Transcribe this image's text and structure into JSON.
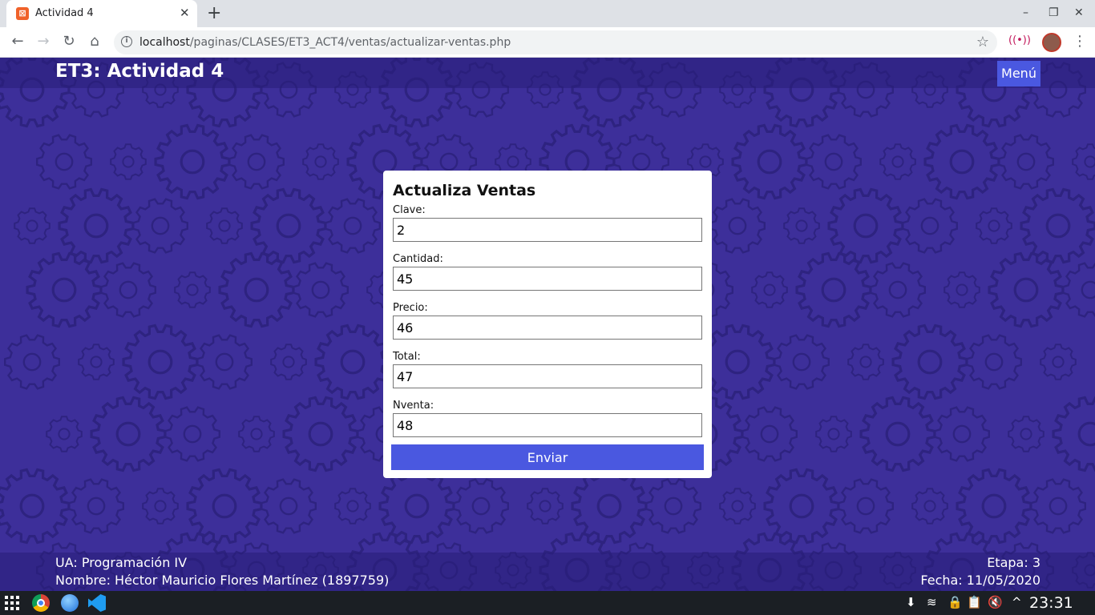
{
  "browser": {
    "tab_title": "Actividad 4",
    "tab_close": "✕",
    "new_tab": "+",
    "window_controls": {
      "minimize": "–",
      "restore": "❐",
      "close": "✕"
    },
    "nav": {
      "back": "←",
      "forward": "→",
      "reload": "↻",
      "home": "⌂"
    },
    "url_host": "localhost",
    "url_path": "/paginas/CLASES/ET3_ACT4/ventas/actualizar-ventas.php",
    "info_icon": "i",
    "star_icon": "☆",
    "cast_icon": "((•))",
    "menu_icon": "⋮"
  },
  "site": {
    "title": "ET3: Actividad 4",
    "menu_label": "Menú"
  },
  "form": {
    "heading": "Actualiza Ventas",
    "fields": [
      {
        "label": "Clave:",
        "value": "2"
      },
      {
        "label": "Cantidad:",
        "value": "45"
      },
      {
        "label": "Precio:",
        "value": "46"
      },
      {
        "label": "Total:",
        "value": "47"
      },
      {
        "label": "Nventa:",
        "value": "48"
      }
    ],
    "submit_label": "Enviar"
  },
  "footer": {
    "ua": "UA: Programación IV",
    "nombre": "Nombre: Héctor Mauricio Flores Martínez (1897759)",
    "etapa": "Etapa: 3",
    "fecha": "Fecha: 11/05/2020"
  },
  "taskbar": {
    "tray_icons": [
      "⬇",
      "≋",
      "🔒",
      "📋",
      "🔇",
      "^"
    ],
    "clock": "23:31"
  },
  "colors": {
    "background": "#3d2f9a",
    "accent": "#4a58e0",
    "gear": "#2e2380"
  }
}
